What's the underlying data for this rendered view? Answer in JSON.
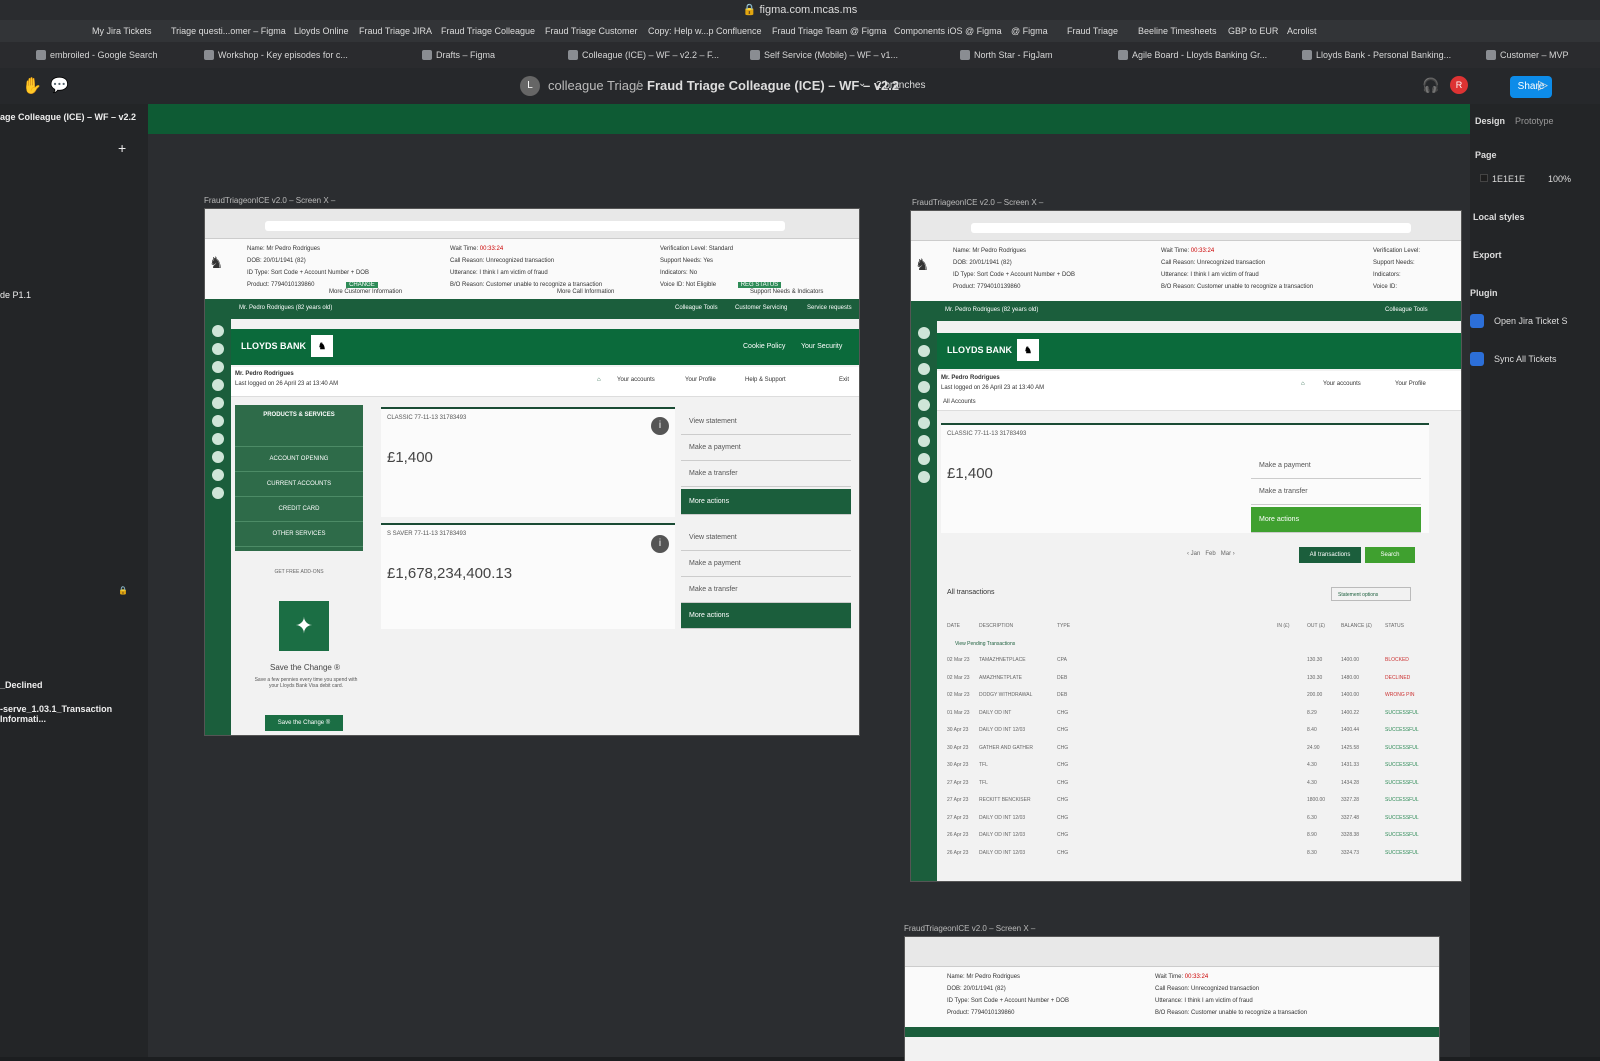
{
  "browser": {
    "url": "figma.com.mcas.ms"
  },
  "bookmarks": [
    "My Jira Tickets",
    "Triage questi...omer – Figma",
    "Lloyds Online",
    "Fraud Triage JIRA",
    "Fraud Triage Colleague",
    "Fraud Triage Customer",
    "Copy: Help w...p Confluence",
    "Fraud Triage Team @ Figma",
    "Components iOS @ Figma",
    "@ Figma",
    "Fraud Triage",
    "Beeline Timesheets",
    "GBP to EUR",
    "Acrolist"
  ],
  "tabs": [
    "embroiled - Google Search",
    "Workshop - Key episodes for c...",
    "Drafts – Figma",
    "Colleague (ICE) – WF – v2.2 – F...",
    "Self Service (Mobile) – WF – v1...",
    "North Star - FigJam",
    "Agile Board - Lloyds Banking Gr...",
    "Lloyds Bank - Personal Banking...",
    "Customer – MVP"
  ],
  "toolbar": {
    "avatar": "L",
    "team": "colleague Triage",
    "sep": "/",
    "file": "Fraud Triage Colleague (ICE) – WF – v2.2",
    "branches": "2 branches",
    "share": "Share",
    "user_initial": "R"
  },
  "left": {
    "file": "age Colleague (ICE) – WF – v2.2",
    "page": "de P1.1",
    "declined": "_Declined",
    "layer": "-serve_1.03.1_Transaction Informati..."
  },
  "right": {
    "tab_design": "Design",
    "tab_prototype": "Prototype",
    "page_heading": "Page",
    "page_color": "1E1E1E",
    "page_opacity": "100%",
    "local_styles": "Local styles",
    "export": "Export",
    "plugin": "Plugin",
    "plugin1": "Open Jira Ticket S",
    "plugin2": "Sync All Tickets"
  },
  "frames": {
    "label": "FraudTriageonICE v2.0 – Screen X –"
  },
  "customer": {
    "name_label": "Name:",
    "name": "Mr Pedro Rodrigues",
    "dob_label": "DOB:",
    "dob": "20/01/1941 (82)",
    "idtype_label": "ID Type:",
    "idtype": "Sort Code + Account Number + DOB",
    "product_label": "Product:",
    "product": "7794010139860",
    "change": "CHANGE",
    "wait_label": "Wait Time:",
    "wait": "00:33:24",
    "reason_label": "Call Reason:",
    "reason": "Unrecognized transaction",
    "utterance_label": "Utterance:",
    "utterance": "I think I am victim of fraud",
    "bo_label": "B/O Reason:",
    "bo": "Customer unable to recognize a transaction",
    "verif_label": "Verification Level:",
    "verif": "Standard",
    "support_label": "Support Needs:",
    "support": "Yes",
    "ind_label": "Indicators:",
    "ind": "No",
    "voice_label": "Voice ID:",
    "voice": "Not Eligible",
    "reg_status": "REG STATUS",
    "more_customer": "More Customer Information",
    "more_call": "More Call Information",
    "support_ind": "Support Needs & Indicators"
  },
  "ribbon": {
    "person": "Mr. Pedro Rodrigues (82 years old)",
    "colleague_tools": "Colleague Tools",
    "customer_servicing": "Customer Servicing",
    "service_requests": "Service requests"
  },
  "bank": {
    "name": "LLOYDS BANK",
    "cookie": "Cookie Policy",
    "security": "Your Security",
    "user": "Mr. Pedro Rodrigues",
    "last_login": "Last logged on 26 April 23 at 13:40 AM",
    "your_accounts": "Your accounts",
    "your_profile": "Your Profile",
    "help": "Help & Support",
    "exit": "Exit",
    "all_accounts": "All Accounts"
  },
  "products": {
    "title": "PRODUCTS & SERVICES",
    "items": [
      "ACCOUNT OPENING",
      "CURRENT ACCOUNTS",
      "CREDIT CARD",
      "OTHER SERVICES"
    ],
    "addons": "GET FREE ADD-ONS",
    "save_title": "Save the Change ®",
    "save_text": "Save a few pennies every time you spend with your Lloyds Bank Visa debit card.",
    "save_btn": "Save the Change ®"
  },
  "accounts": [
    {
      "label": "CLASSIC  77-11-13  31783493",
      "amount": "£1,400",
      "actions": [
        "View statement",
        "Make a payment",
        "Make a transfer",
        "More actions"
      ]
    },
    {
      "label": "S SAVER  77-11-13  31783493",
      "amount": "£1,678,234,400.13",
      "actions": [
        "View statement",
        "Make a payment",
        "Make a transfer",
        "More actions"
      ]
    }
  ],
  "tx": {
    "months": [
      "Jan",
      "Feb",
      "Mar"
    ],
    "all_tx_btn": "All transactions",
    "search_btn": "Search",
    "heading": "All transactions",
    "options": "Statement options",
    "cols": [
      "DATE",
      "DESCRIPTION",
      "TYPE",
      "IN (£)",
      "OUT (£)",
      "BALANCE (£)",
      "STATUS"
    ],
    "pending": "View Pending Transactions",
    "rows": [
      [
        "02 Mar 23",
        "TAMAZHNETPLACE",
        "CPA",
        "",
        "130.30",
        "1400.00",
        "BLOCKED"
      ],
      [
        "02 Mar 23",
        "AMAZHNETPLATE",
        "DEB",
        "",
        "130.30",
        "1480.00",
        "DECLINED"
      ],
      [
        "02 Mar 23",
        "DODGY WITHDRAWAL",
        "DEB",
        "",
        "200.00",
        "1400.00",
        "WRONG PIN"
      ],
      [
        "01 Mar 23",
        "DAILY OD INT",
        "CHG",
        "",
        "8.29",
        "1400.22",
        "SUCCESSFUL"
      ],
      [
        "30 Apr 23",
        "DAILY OD INT 12/03",
        "CHG",
        "",
        "8.40",
        "1400.44",
        "SUCCESSFUL"
      ],
      [
        "30 Apr 23",
        "GATHER AND GATHER",
        "CHG",
        "",
        "24.90",
        "1425.58",
        "SUCCESSFUL"
      ],
      [
        "30 Apr 23",
        "TFL",
        "CHG",
        "",
        "4.30",
        "1431.33",
        "SUCCESSFUL"
      ],
      [
        "27 Apr 23",
        "TFL",
        "CHG",
        "",
        "4.30",
        "1434.28",
        "SUCCESSFUL"
      ],
      [
        "27 Apr 23",
        "RECKITT BENCKISER",
        "CHG",
        "",
        "1800.00",
        "3327.28",
        "SUCCESSFUL"
      ],
      [
        "27 Apr 23",
        "DAILY OD INT 12/03",
        "CHG",
        "",
        "6.30",
        "3327.48",
        "SUCCESSFUL"
      ],
      [
        "26 Apr 23",
        "DAILY OD INT 12/03",
        "CHG",
        "",
        "8.90",
        "3328.38",
        "SUCCESSFUL"
      ],
      [
        "26 Apr 23",
        "DAILY OD INT 12/03",
        "CHG",
        "",
        "8.30",
        "3324.73",
        "SUCCESSFUL"
      ]
    ]
  },
  "colors": {
    "green": "#1b5e3c",
    "lime": "#3fa02f",
    "figma_blue": "#0d8ce9"
  }
}
